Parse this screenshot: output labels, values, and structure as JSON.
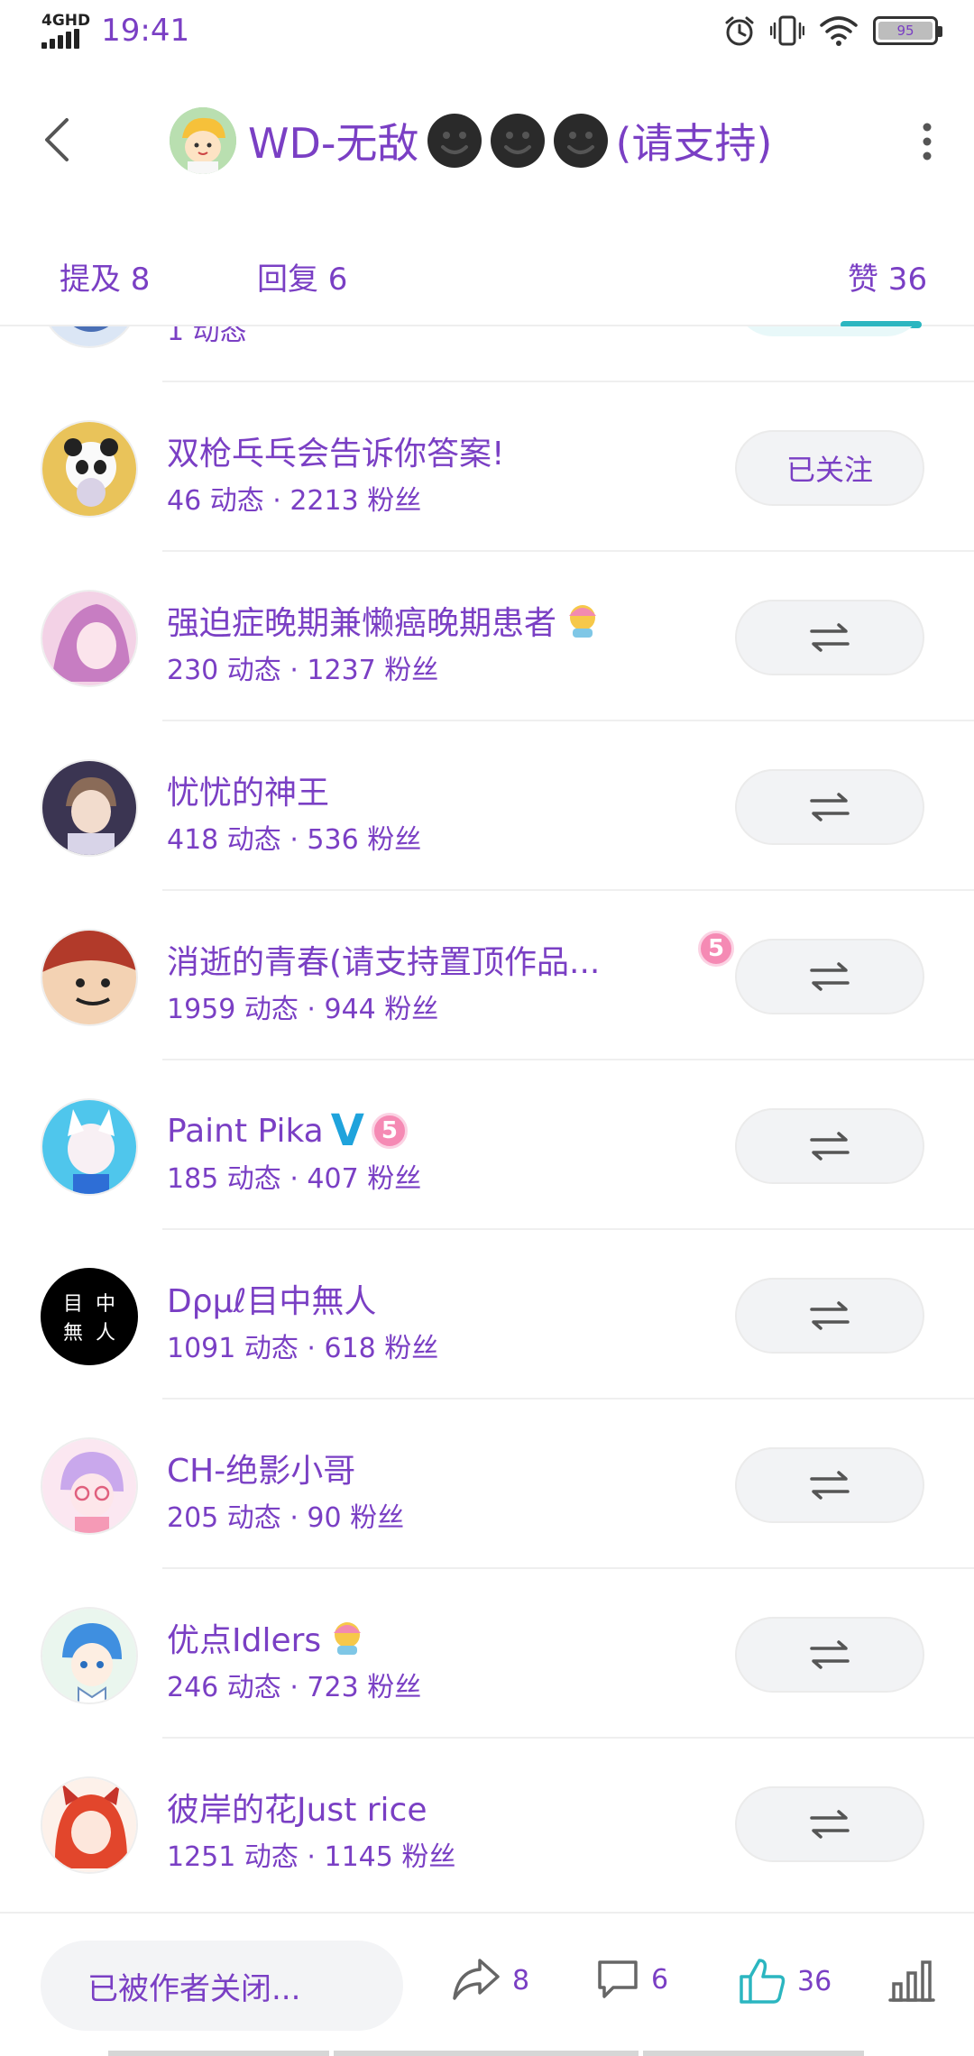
{
  "status_bar": {
    "network": "4GHD",
    "time": "19:41",
    "battery": "95"
  },
  "header": {
    "title": "WD-无敌",
    "title_suffix": "(请支持)"
  },
  "tabs": [
    {
      "label": "提及 8"
    },
    {
      "label": "回复 6"
    },
    {
      "label": "赞 36",
      "active": true
    }
  ],
  "users": [
    {
      "name": "",
      "meta": "1 动态",
      "button": ""
    },
    {
      "name": "双枪乓乓会告诉你答案!",
      "meta": "46 动态 · 2213 粉丝",
      "button": "已关注"
    },
    {
      "name": "强迫症晚期兼懒癌晚期患者",
      "meta": "230 动态 · 1237 粉丝",
      "button": "⇄"
    },
    {
      "name": "忧忧的神王",
      "meta": "418 动态 · 536 粉丝",
      "button": "⇄"
    },
    {
      "name": "消逝的青春(请支持置顶作品...",
      "meta": "1959 动态 · 944 粉丝",
      "button": "⇄",
      "badge": "5"
    },
    {
      "name": "Paint Pika",
      "meta": "185 动态 · 407 粉丝",
      "button": "⇄",
      "verified": "V",
      "badge": "5"
    },
    {
      "name": "Dρμℓ目中無人",
      "meta": "1091 动态 · 618 粉丝",
      "button": "⇄",
      "avatar_text": [
        "目",
        "中",
        "無",
        "人"
      ]
    },
    {
      "name": "CH-绝影小哥",
      "meta": "205 动态 · 90 粉丝",
      "button": "⇄"
    },
    {
      "name": "优点Idlers",
      "meta": "246 动态 · 723 粉丝",
      "button": "⇄"
    },
    {
      "name": "彼岸的花Just rice",
      "meta": "1251 动态 · 1145 粉丝",
      "button": "⇄"
    }
  ],
  "bottom_bar": {
    "comment_placeholder": "已被作者关闭...",
    "share_count": "8",
    "comment_count": "6",
    "like_count": "36"
  },
  "colors": {
    "accent_teal": "#2bb6c0",
    "text_purple": "#7a3fc4",
    "button_bg": "#f2f3f5"
  }
}
